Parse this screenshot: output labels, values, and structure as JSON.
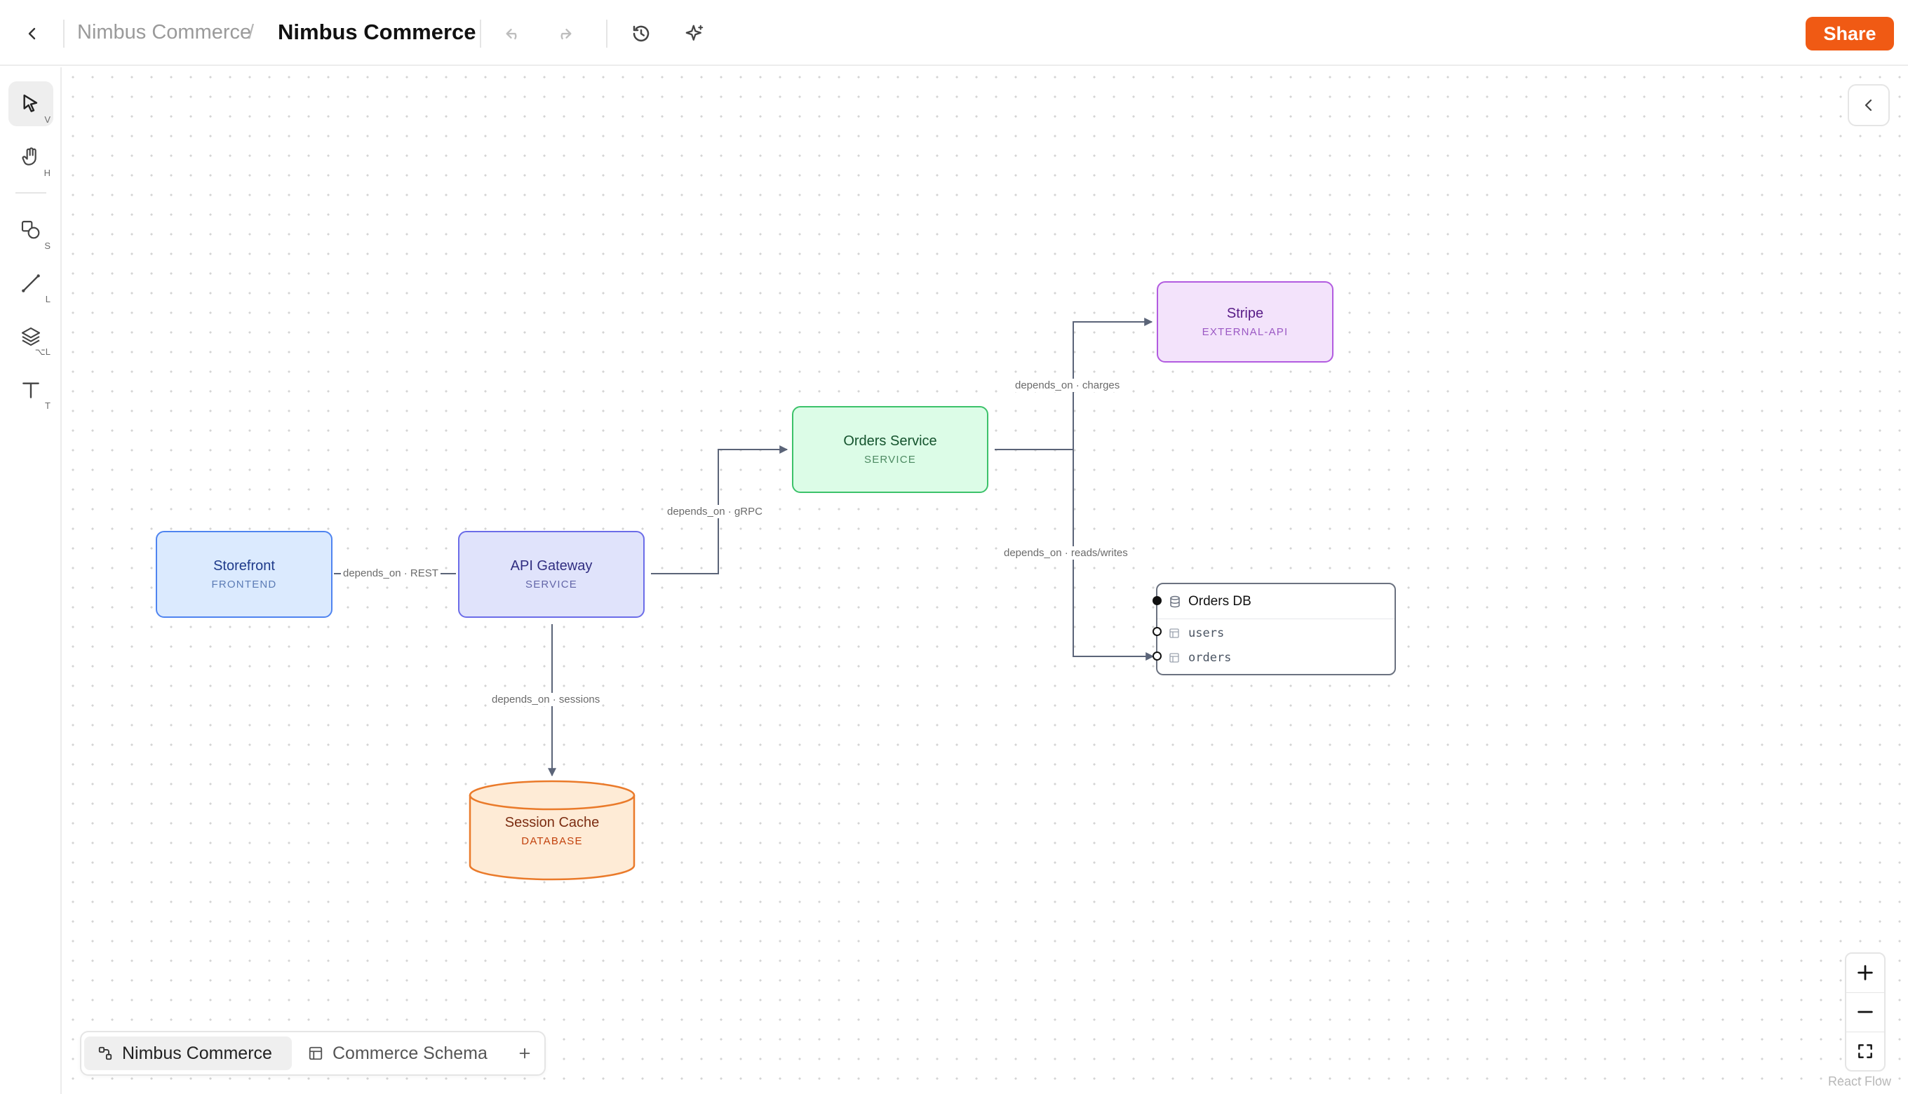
{
  "header": {
    "breadcrumb_parent": "Nimbus Commerce",
    "breadcrumb_separator": "/",
    "title": "Nimbus Commerce",
    "share_label": "Share",
    "accent_color": "#f05a14"
  },
  "toolbar": {
    "tools": [
      {
        "name": "select",
        "icon": "cursor-icon",
        "key": "V"
      },
      {
        "name": "hand",
        "icon": "hand-icon",
        "key": "H"
      },
      {
        "name": "shapes",
        "icon": "shapes-icon",
        "key": "S"
      },
      {
        "name": "line",
        "icon": "line-icon",
        "key": "L"
      },
      {
        "name": "layers",
        "icon": "layers-icon",
        "key": "⌥L"
      },
      {
        "name": "text",
        "icon": "text-icon",
        "key": "T"
      }
    ]
  },
  "diagram": {
    "nodes": [
      {
        "id": "storefront",
        "title": "Storefront",
        "type": "FRONTEND"
      },
      {
        "id": "api-gateway",
        "title": "API Gateway",
        "type": "SERVICE"
      },
      {
        "id": "orders-service",
        "title": "Orders Service",
        "type": "SERVICE"
      },
      {
        "id": "stripe",
        "title": "Stripe",
        "type": "EXTERNAL-API"
      },
      {
        "id": "session-cache",
        "title": "Session Cache",
        "type": "DATABASE"
      },
      {
        "id": "orders-db",
        "title": "Orders DB",
        "tables": [
          "users",
          "orders"
        ]
      }
    ],
    "edges": [
      {
        "from": "storefront",
        "to": "api-gateway",
        "label": "depends_on · REST"
      },
      {
        "from": "api-gateway",
        "to": "orders-service",
        "label": "depends_on · gRPC"
      },
      {
        "from": "orders-service",
        "to": "stripe",
        "label": "depends_on · charges"
      },
      {
        "from": "orders-service",
        "to": "orders-db",
        "label": "depends_on · reads/writes"
      },
      {
        "from": "api-gateway",
        "to": "session-cache",
        "label": "depends_on · sessions"
      }
    ]
  },
  "zoom_controls": {
    "zoom_in": "+",
    "zoom_out": "—"
  },
  "attribution": "React Flow",
  "pages": {
    "tabs": [
      {
        "label": "Nimbus Commerce",
        "icon": "diagram-icon",
        "active": true
      },
      {
        "label": "Commerce Schema",
        "icon": "table-icon",
        "active": false
      }
    ],
    "add_label": "+"
  }
}
